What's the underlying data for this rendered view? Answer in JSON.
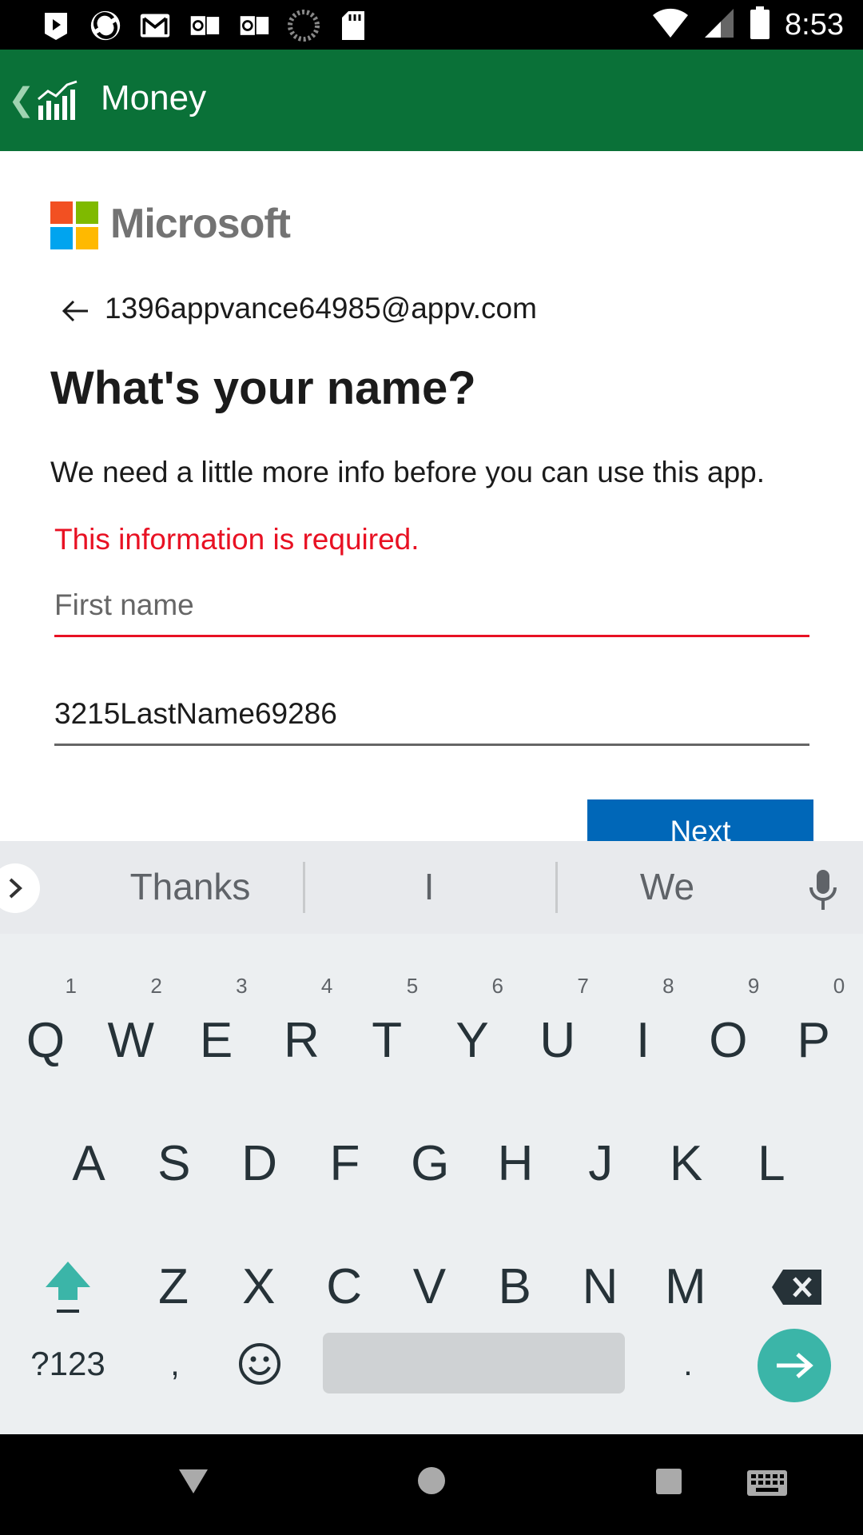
{
  "status_bar": {
    "time": "8:53",
    "left_icons": [
      "play-icon",
      "sync-icon",
      "gmail-icon",
      "outlook-icon",
      "outlook-icon",
      "loading-icon",
      "sd-card-icon"
    ],
    "right_icons": [
      "wifi-icon",
      "signal-icon",
      "battery-icon"
    ]
  },
  "app_bar": {
    "title": "Money",
    "color": "#0a7138"
  },
  "signin": {
    "brand": "Microsoft",
    "email": "1396appvance64985@appv.com",
    "heading": "What's your name?",
    "description": "We need a little more info before you can use this app.",
    "error": "This information is required.",
    "first_name": {
      "placeholder": "First name",
      "value": ""
    },
    "last_name": {
      "value": "3215LastName69286"
    },
    "next_label": "Next",
    "error_color": "#e81123",
    "accent_color": "#0067b8"
  },
  "keyboard": {
    "suggestions": [
      "Thanks",
      "I",
      "We"
    ],
    "row1": [
      {
        "key": "Q",
        "hint": "1"
      },
      {
        "key": "W",
        "hint": "2"
      },
      {
        "key": "E",
        "hint": "3"
      },
      {
        "key": "R",
        "hint": "4"
      },
      {
        "key": "T",
        "hint": "5"
      },
      {
        "key": "Y",
        "hint": "6"
      },
      {
        "key": "U",
        "hint": "7"
      },
      {
        "key": "I",
        "hint": "8"
      },
      {
        "key": "O",
        "hint": "9"
      },
      {
        "key": "P",
        "hint": "0"
      }
    ],
    "row2": [
      "A",
      "S",
      "D",
      "F",
      "G",
      "H",
      "J",
      "K",
      "L"
    ],
    "row3": [
      "Z",
      "X",
      "C",
      "V",
      "B",
      "N",
      "M"
    ],
    "symbols_label": "?123",
    "comma": ",",
    "period": ".",
    "accent_color": "#3bb5a8"
  }
}
